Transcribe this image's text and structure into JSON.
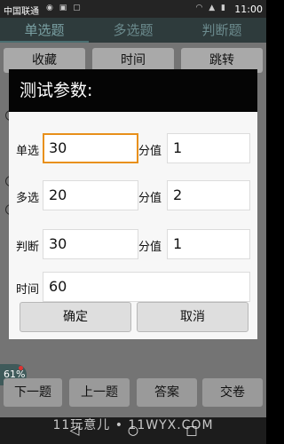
{
  "status_bar": {
    "carrier": "中国联通",
    "time": "11:00",
    "icons": [
      "wechat-icon",
      "image-icon",
      "notification-icon",
      "wifi-icon",
      "signal-icon",
      "battery-icon"
    ]
  },
  "tabs": [
    {
      "label": "单选题"
    },
    {
      "label": "多选题"
    },
    {
      "label": "判断题"
    }
  ],
  "top_buttons": [
    {
      "label": "收藏"
    },
    {
      "label": "时间"
    },
    {
      "label": "跳转"
    }
  ],
  "dialog": {
    "title": "测试参数:",
    "rows": [
      {
        "label": "单选",
        "value": "30",
        "score_label": "分值",
        "score": "1"
      },
      {
        "label": "多选",
        "value": "20",
        "score_label": "分值",
        "score": "2"
      },
      {
        "label": "判断",
        "value": "30",
        "score_label": "分值",
        "score": "1"
      }
    ],
    "time_label": "时间",
    "time_value": "60",
    "confirm_label": "确定",
    "cancel_label": "取消"
  },
  "progress": {
    "percent_text": "61%"
  },
  "bottom_buttons": [
    {
      "label": "下一题"
    },
    {
      "label": "上一题"
    },
    {
      "label": "答案"
    },
    {
      "label": "交卷"
    }
  ],
  "watermark": "11玩意儿 • 11WYX.COM",
  "colors": {
    "focus_border": "#e8901a",
    "title_bar": "#050505"
  }
}
